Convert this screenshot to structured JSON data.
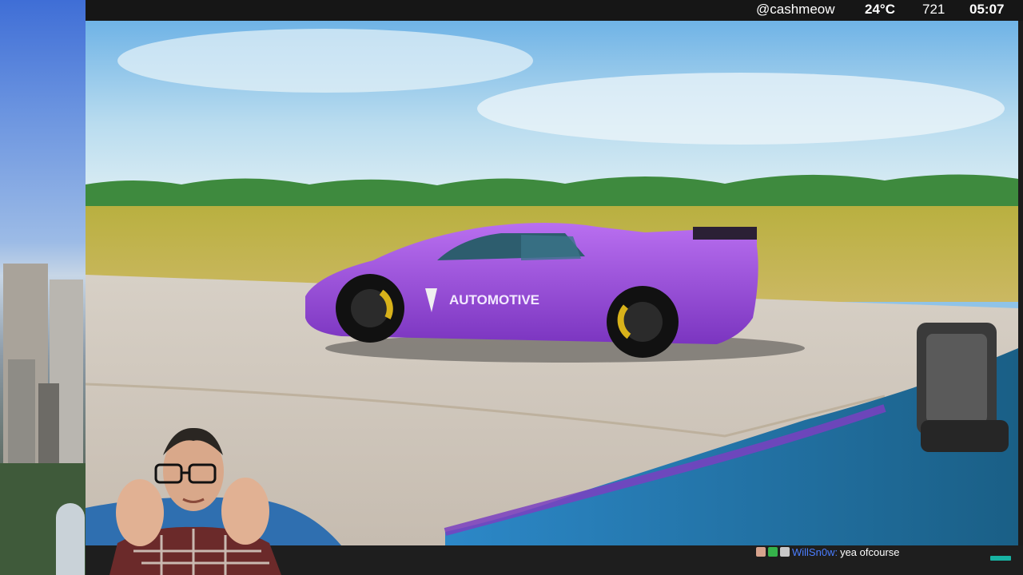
{
  "status_bar": {
    "channel": "@cashmeow",
    "temperature": "24°C",
    "count": "721",
    "clock": "05:07"
  },
  "video": {
    "car_decal_text": "AUTOMOTIVE"
  },
  "chat": {
    "username": "WillSn0w:",
    "message": "yea ofcourse",
    "badge_icons": [
      "user-avatar-badge",
      "verified-check-badge",
      "clapper-badge"
    ]
  },
  "colors": {
    "accent_username": "#4a7dff",
    "car_body": "#9a4fd8",
    "corner_badge": "#17b3a3"
  }
}
